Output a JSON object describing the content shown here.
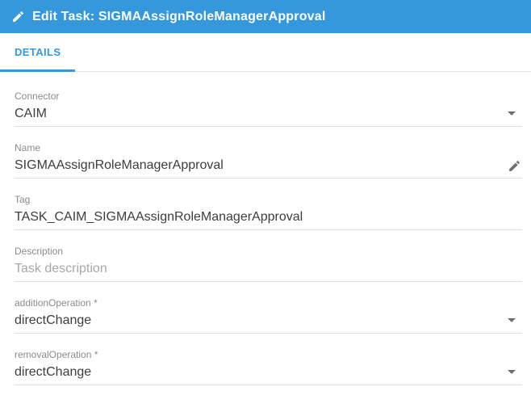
{
  "colors": {
    "accent": "#3598dc",
    "header_bg": "#3598dc",
    "underline": "#e0e0e0",
    "label_gray": "#8b8b8b",
    "value_dark": "#3d3d3d",
    "placeholder_gray": "#a8a8a8",
    "icon_gray": "#6f6f6f"
  },
  "header": {
    "icon": "pencil-icon",
    "title": "Edit Task: SIGMAAssignRoleManagerApproval"
  },
  "tabs": {
    "details": {
      "label": "DETAILS",
      "active": true
    }
  },
  "form": {
    "fields": {
      "connector": {
        "label": "Connector",
        "value": "CAIM",
        "type": "select"
      },
      "name": {
        "label": "Name",
        "value": "SIGMAAssignRoleManagerApproval",
        "type": "text",
        "trailing_icon": "pencil-icon"
      },
      "tag": {
        "label": "Tag",
        "value": "TASK_CAIM_SIGMAAssignRoleManagerApproval",
        "type": "text"
      },
      "description": {
        "label": "Description",
        "value": "",
        "placeholder": "Task description",
        "type": "text"
      },
      "additionOperation": {
        "label": "additionOperation *",
        "value": "directChange",
        "type": "select"
      },
      "removalOperation": {
        "label": "removalOperation *",
        "value": "directChange",
        "type": "select"
      }
    }
  }
}
